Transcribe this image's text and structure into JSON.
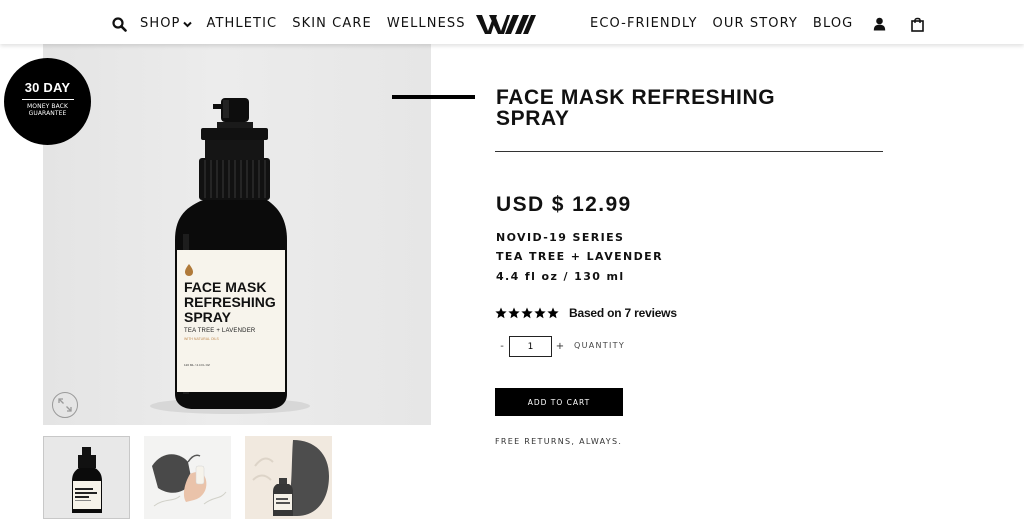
{
  "nav": {
    "shop": "SHOP",
    "athletic": "ATHLETIC",
    "skin_care": "SKIN CARE",
    "wellness": "WELLNESS",
    "eco_friendly": "ECO-FRIENDLY",
    "our_story": "OUR STORY",
    "blog": "BLOG",
    "icons": [
      "search-icon",
      "chevron-down-icon",
      "user-icon",
      "shopping-bag-icon"
    ]
  },
  "badge": {
    "big": "30 DAY",
    "small_line1": "MONEY BACK",
    "small_line2": "GUARANTEE"
  },
  "bottle_label": {
    "line1": "FACE MASK",
    "line2": "REFRESHING",
    "line3": "SPRAY",
    "sub": "TEA TREE + LAVENDER",
    "note": "WITH NATURAL OILS",
    "volume": "120 ML / 4.4 FL OZ"
  },
  "product": {
    "title_line1": "FACE MASK REFRESHING",
    "title_line2": "SPRAY",
    "price": "USD $ 12.99",
    "series": "NOVID-19 SERIES",
    "scent": "TEA TREE + LAVENDER",
    "size": "4.4 fl oz / 130 ml",
    "rating": 5,
    "reviews_text": "Based on 7 reviews",
    "quantity": "1",
    "qty_minus": "-",
    "qty_plus": "+",
    "quantity_label": "QUANTITY",
    "add_to_cart": "ADD TO CART",
    "free_returns": "FREE RETURNS, ALWAYS."
  }
}
